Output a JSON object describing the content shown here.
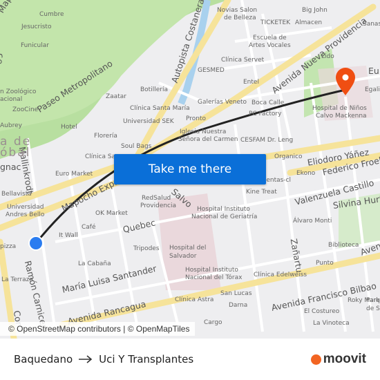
{
  "map": {
    "cta_label": "Take me there",
    "attribution": "© OpenStreetMap contributors | © OpenMapTiles",
    "origin_color": "#2a7cf0",
    "destination_color": "#f04e12",
    "route_color": "#222222",
    "streets": [
      "Paseo Metropolitano",
      "Autopista Costanera",
      "Avenida Nueva Providencia",
      "Eliodoro Yáñez",
      "Federico Froebel",
      "Valenzuela Castillo",
      "Silvina Hurtado",
      "Mapocho Express",
      "Quebec",
      "María Luisa Santander",
      "Avenida Rancagua",
      "Avenida Francisco Bilbao",
      "Ramón Carnicer",
      "Mallinkrodt",
      "Zañartu",
      "Salvo",
      "Cor",
      "Eu",
      "Aven",
      "Se",
      "Mapo",
      "gnac"
    ],
    "places": [
      "Cumbre",
      "Jesucristo",
      "Funicular",
      "n Zoológico",
      "acional",
      "ZooCine",
      "Aubrey",
      "Hotel",
      "Zaatar",
      "Botillería",
      "Clínica Santa María",
      "Universidad SEK",
      "Florería",
      "Soul Bags",
      "Clínica Sa",
      "Euro Market",
      "Bellavista",
      "Universidad",
      "Andres Bello",
      "OK Market",
      "Café",
      "It Wall",
      "RedSalud",
      "Providencia",
      "Tripodes",
      "La Cabaña",
      "La Terraza",
      "pizza",
      "Hospital del",
      "Salvador",
      "Hospital Instituto",
      "Nacional de Geriatría",
      "Hospital Instituto",
      "Nacional del Tórax",
      "Clínica Astra",
      "San Lucas",
      "Darna",
      "Clínica Edelweiss",
      "Punto",
      "Biblioteca",
      "Álvaro Monti",
      "Kine Treat",
      "Ekono",
      "ventas-cl",
      "Organico",
      "CESFAM Dr. Leng",
      "Iglesia Nuestra",
      "Señora del Carmen",
      "Pronto",
      "Galerías Veneto",
      "Boca Calle",
      "PC Factory",
      "Entel",
      "GESMED",
      "Clínica Servet",
      "Escuela de",
      "Artes Vocales",
      "Novias Salon",
      "de Belleza",
      "TICKETEK",
      "Almacen",
      "Big John",
      "Sanas",
      "Lido",
      "Egali",
      "Hospital de Niños",
      "Calvo Mackenna",
      "Roky Marke",
      "Parq",
      "de S",
      "El Costureo",
      "La Vinoteca",
      "Cargo"
    ],
    "district": [
      "a de",
      "óbal"
    ]
  },
  "footer": {
    "origin": "Baquedano",
    "destination": "Uci Y Transplantes",
    "arrow_icon": "arrow-right",
    "brand": "moovit",
    "brand_color": "#f26522"
  }
}
